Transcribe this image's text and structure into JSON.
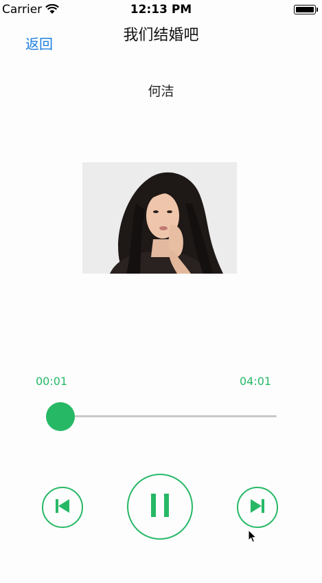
{
  "status_bar": {
    "carrier": "Carrier",
    "time": "12:13 PM"
  },
  "nav": {
    "back_label": "返回",
    "title": "我们结婚吧"
  },
  "song": {
    "artist": "何洁"
  },
  "player": {
    "current_time": "00:01",
    "total_time": "04:01",
    "progress": 0.0041,
    "state": "playing"
  },
  "controls": {
    "prev_icon": "skip-previous-icon",
    "pause_icon": "pause-icon",
    "next_icon": "skip-next-icon"
  },
  "colors": {
    "accent": "#27b866",
    "link": "#1a7ee3",
    "track": "#c8c8c8"
  }
}
